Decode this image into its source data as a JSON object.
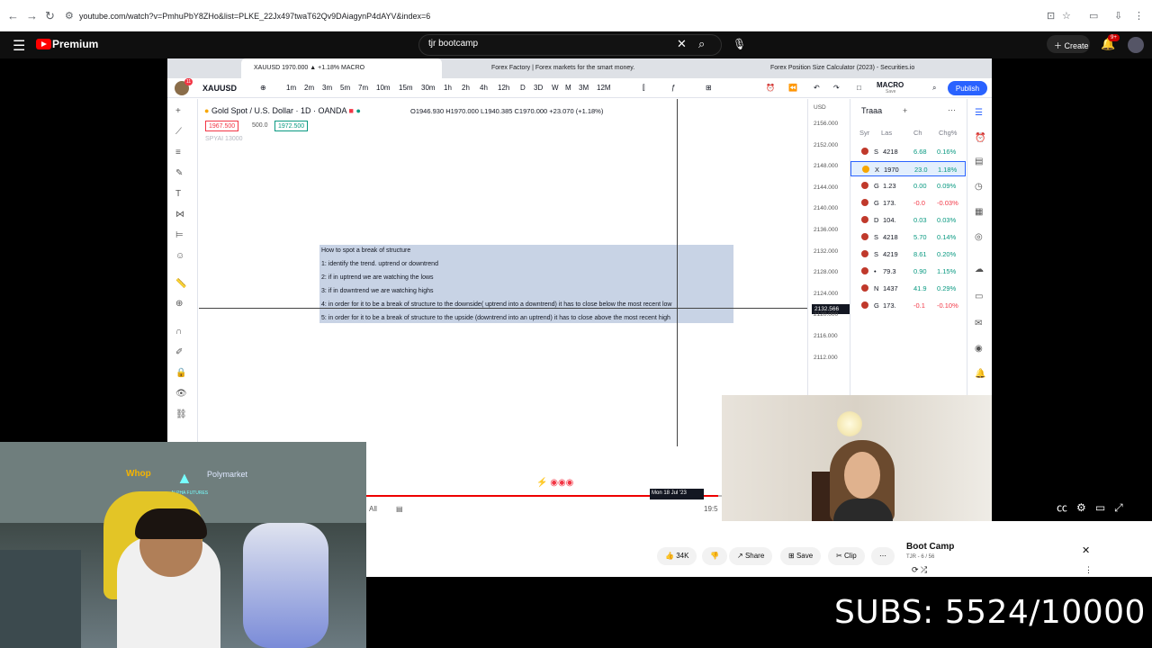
{
  "browser": {
    "url": "youtube.com/watch?v=PmhuPbY8ZHo&list=PLKE_22Jx497twaT62Qv9DAiagynP4dAYV&index=6",
    "back": "←",
    "forward": "→",
    "reload": "↻"
  },
  "yt": {
    "brand": "Premium",
    "search_value": "tjr bootcamp",
    "create_label": "Create",
    "notif_count": "9+"
  },
  "tabs": [
    {
      "label": "XAUUSD 1970.000 ▲ +1.18% MACRO"
    },
    {
      "label": "Forex Factory | Forex markets for the smart money."
    },
    {
      "label": "Forex Position Size Calculator (2023) - Securities.io"
    }
  ],
  "toolbar": {
    "badge": "11",
    "symbol": "XAUUSD",
    "intervals": [
      "1m",
      "2m",
      "3m",
      "5m",
      "7m",
      "10m",
      "15m",
      "30m",
      "1h",
      "2h",
      "4h",
      "12h",
      "D",
      "3D",
      "W",
      "M",
      "3M",
      "12M"
    ],
    "layout_name": "MACRO",
    "layout_sub": "Save",
    "publish": "Publish"
  },
  "chart": {
    "title": "Gold Spot / U.S. Dollar · 1D · OANDA",
    "ohlc": "O1946.930  H1970.000  L1940.385  C1970.000  +23.070 (+1.18%)",
    "bid": "1967.500",
    "spread": "500.0",
    "ask": "1972.500",
    "indicator": "SPYAI 13000",
    "currency": "USD",
    "notes": [
      "How to spot a break of structure",
      "1: identify the trend. uptrend or downtrend",
      "2: if in uptrend we are watching the lows",
      "3: if in downtrend we are watching highs",
      "4: in order for it to be a break of structure to the downside( uptrend into a downtrend) it has to close below the most recent low",
      "5: in order for it to be a break of structure to the upside (downtrend into an uptrend) it has to close above the most recent high"
    ],
    "price_ticks": [
      "2156.000",
      "2152.000",
      "2148.000",
      "2144.000",
      "2140.000",
      "2136.000",
      "2132.000",
      "2128.000",
      "2124.000",
      "2120.000",
      "2116.000",
      "2112.000"
    ],
    "crosshair_price": "2132.566"
  },
  "watchlist": {
    "title": "Traaa",
    "columns": [
      "Syr",
      "Las",
      "Ch",
      "Chg%"
    ],
    "rows": [
      {
        "sym": "S",
        "last": "4218",
        "chg": "6.68",
        "pct": "0.16%",
        "color": "#089981"
      },
      {
        "sym": "X",
        "last": "1970",
        "chg": "23.0",
        "pct": "1.18%",
        "color": "#089981"
      },
      {
        "sym": "G",
        "last": "1.23",
        "chg": "0.00",
        "pct": "0.09%",
        "color": "#089981"
      },
      {
        "sym": "G",
        "last": "173.",
        "chg": "-0.0",
        "pct": "-0.03%",
        "color": "#f23645"
      },
      {
        "sym": "D",
        "last": "104.",
        "chg": "0.03",
        "pct": "0.03%",
        "color": "#089981"
      },
      {
        "sym": "S",
        "last": "4218",
        "chg": "5.70",
        "pct": "0.14%",
        "color": "#089981"
      },
      {
        "sym": "S",
        "last": "4219",
        "chg": "8.61",
        "pct": "0.20%",
        "color": "#089981"
      },
      {
        "sym": "•",
        "last": "79.3",
        "chg": "0.90",
        "pct": "1.15%",
        "color": "#089981"
      },
      {
        "sym": "N",
        "last": "1437",
        "chg": "41.9",
        "pct": "0.29%",
        "color": "#089981"
      },
      {
        "sym": "G",
        "last": "173.",
        "chg": "-0.1",
        "pct": "-0.10%",
        "color": "#f23645"
      }
    ]
  },
  "timeline": {
    "all": "All",
    "time": "19:5",
    "date_tag": "Mon 18 Jul '23"
  },
  "webcam": {
    "sponsor1": "Whop",
    "sponsor2": "Polymarket",
    "sponsor3": "ALPHA FUTURES"
  },
  "actions": {
    "likes": "34K",
    "share": "Share",
    "save": "Save",
    "clip": "Clip"
  },
  "playlist": {
    "title": "Boot Camp",
    "sub": "TJR - 6 / 56"
  },
  "overlay": {
    "subs": "SUBS: 5524/10000"
  }
}
